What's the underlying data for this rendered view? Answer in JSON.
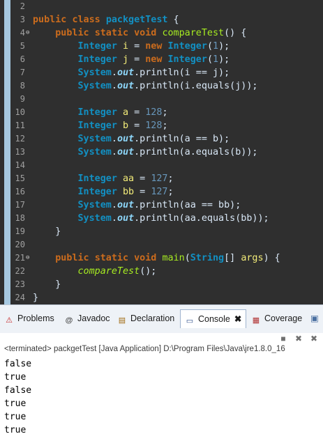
{
  "editor": {
    "lines": [
      {
        "num": "2",
        "fold": "",
        "tokens": []
      },
      {
        "num": "3",
        "fold": "",
        "tokens": [
          [
            "kw",
            "public"
          ],
          [
            "pl",
            " "
          ],
          [
            "kw",
            "class"
          ],
          [
            "pl",
            " "
          ],
          [
            "ty",
            "packgetTest"
          ],
          [
            "pl",
            " {"
          ]
        ]
      },
      {
        "num": "4",
        "fold": "⊖",
        "tokens": [
          [
            "pl",
            "    "
          ],
          [
            "kw",
            "public"
          ],
          [
            "pl",
            " "
          ],
          [
            "kw",
            "static"
          ],
          [
            "pl",
            " "
          ],
          [
            "kw",
            "void"
          ],
          [
            "pl",
            " "
          ],
          [
            "fn",
            "compareTest"
          ],
          [
            "pl",
            "() {"
          ]
        ]
      },
      {
        "num": "5",
        "fold": "",
        "tokens": [
          [
            "pl",
            "        "
          ],
          [
            "ty",
            "Integer"
          ],
          [
            "pl",
            " "
          ],
          [
            "va",
            "i"
          ],
          [
            "pl",
            " = "
          ],
          [
            "kw",
            "new"
          ],
          [
            "pl",
            " "
          ],
          [
            "ty",
            "Integer"
          ],
          [
            "pl",
            "("
          ],
          [
            "nb",
            "1"
          ],
          [
            "pl",
            ");"
          ]
        ]
      },
      {
        "num": "6",
        "fold": "",
        "tokens": [
          [
            "pl",
            "        "
          ],
          [
            "ty",
            "Integer"
          ],
          [
            "pl",
            " "
          ],
          [
            "va",
            "j"
          ],
          [
            "pl",
            " = "
          ],
          [
            "kw",
            "new"
          ],
          [
            "pl",
            " "
          ],
          [
            "ty",
            "Integer"
          ],
          [
            "pl",
            "("
          ],
          [
            "nb",
            "1"
          ],
          [
            "pl",
            ");"
          ]
        ]
      },
      {
        "num": "7",
        "fold": "",
        "tokens": [
          [
            "pl",
            "        "
          ],
          [
            "ty",
            "System"
          ],
          [
            "pl",
            "."
          ],
          [
            "fi",
            "out"
          ],
          [
            "pl",
            ".println(i == j);"
          ]
        ]
      },
      {
        "num": "8",
        "fold": "",
        "tokens": [
          [
            "pl",
            "        "
          ],
          [
            "ty",
            "System"
          ],
          [
            "pl",
            "."
          ],
          [
            "fi",
            "out"
          ],
          [
            "pl",
            ".println(i.equals(j));"
          ]
        ]
      },
      {
        "num": "9",
        "fold": "",
        "tokens": []
      },
      {
        "num": "10",
        "fold": "",
        "tokens": [
          [
            "pl",
            "        "
          ],
          [
            "ty",
            "Integer"
          ],
          [
            "pl",
            " "
          ],
          [
            "va",
            "a"
          ],
          [
            "pl",
            " = "
          ],
          [
            "nb",
            "128"
          ],
          [
            "pl",
            ";"
          ]
        ]
      },
      {
        "num": "11",
        "fold": "",
        "tokens": [
          [
            "pl",
            "        "
          ],
          [
            "ty",
            "Integer"
          ],
          [
            "pl",
            " "
          ],
          [
            "va",
            "b"
          ],
          [
            "pl",
            " = "
          ],
          [
            "nb",
            "128"
          ],
          [
            "pl",
            ";"
          ]
        ]
      },
      {
        "num": "12",
        "fold": "",
        "tokens": [
          [
            "pl",
            "        "
          ],
          [
            "ty",
            "System"
          ],
          [
            "pl",
            "."
          ],
          [
            "fi",
            "out"
          ],
          [
            "pl",
            ".println(a == b);"
          ]
        ]
      },
      {
        "num": "13",
        "fold": "",
        "tokens": [
          [
            "pl",
            "        "
          ],
          [
            "ty",
            "System"
          ],
          [
            "pl",
            "."
          ],
          [
            "fi",
            "out"
          ],
          [
            "pl",
            ".println(a.equals(b));"
          ]
        ]
      },
      {
        "num": "14",
        "fold": "",
        "tokens": []
      },
      {
        "num": "15",
        "fold": "",
        "tokens": [
          [
            "pl",
            "        "
          ],
          [
            "ty",
            "Integer"
          ],
          [
            "pl",
            " "
          ],
          [
            "va",
            "aa"
          ],
          [
            "pl",
            " = "
          ],
          [
            "nb",
            "127"
          ],
          [
            "pl",
            ";"
          ]
        ]
      },
      {
        "num": "16",
        "fold": "",
        "tokens": [
          [
            "pl",
            "        "
          ],
          [
            "ty",
            "Integer"
          ],
          [
            "pl",
            " "
          ],
          [
            "va",
            "bb"
          ],
          [
            "pl",
            " = "
          ],
          [
            "nb",
            "127"
          ],
          [
            "pl",
            ";"
          ]
        ]
      },
      {
        "num": "17",
        "fold": "",
        "tokens": [
          [
            "pl",
            "        "
          ],
          [
            "ty",
            "System"
          ],
          [
            "pl",
            "."
          ],
          [
            "fi",
            "out"
          ],
          [
            "pl",
            ".println(aa == bb);"
          ]
        ]
      },
      {
        "num": "18",
        "fold": "",
        "tokens": [
          [
            "pl",
            "        "
          ],
          [
            "ty",
            "System"
          ],
          [
            "pl",
            "."
          ],
          [
            "fi",
            "out"
          ],
          [
            "pl",
            ".println(aa.equals(bb));"
          ]
        ]
      },
      {
        "num": "19",
        "fold": "",
        "tokens": [
          [
            "pl",
            "    }"
          ]
        ]
      },
      {
        "num": "20",
        "fold": "",
        "tokens": []
      },
      {
        "num": "21",
        "fold": "⊖",
        "tokens": [
          [
            "pl",
            "    "
          ],
          [
            "kw",
            "public"
          ],
          [
            "pl",
            " "
          ],
          [
            "kw",
            "static"
          ],
          [
            "pl",
            " "
          ],
          [
            "kw",
            "void"
          ],
          [
            "pl",
            " "
          ],
          [
            "fn",
            "main"
          ],
          [
            "pl",
            "("
          ],
          [
            "ty",
            "String"
          ],
          [
            "pl",
            "[] "
          ],
          [
            "va",
            "args"
          ],
          [
            "pl",
            ") {"
          ]
        ]
      },
      {
        "num": "22",
        "fold": "",
        "tokens": [
          [
            "pl",
            "        "
          ],
          [
            "ca",
            "compareTest"
          ],
          [
            "pl",
            "();"
          ]
        ]
      },
      {
        "num": "23",
        "fold": "",
        "tokens": [
          [
            "pl",
            "    }"
          ]
        ]
      },
      {
        "num": "24",
        "fold": "",
        "tokens": [
          [
            "pl",
            "}"
          ]
        ]
      }
    ]
  },
  "panel": {
    "tabs": [
      {
        "label": "Problems",
        "icon": "problems-icon",
        "glyph": "⚠",
        "color": "#c62828"
      },
      {
        "label": "Javadoc",
        "icon": "javadoc-icon",
        "glyph": "@",
        "color": "#4a4a4a"
      },
      {
        "label": "Declaration",
        "icon": "declaration-icon",
        "glyph": "▤",
        "color": "#a06a10"
      },
      {
        "label": "Console",
        "icon": "console-icon",
        "glyph": "▭",
        "color": "#2e4f8a",
        "active": true
      },
      {
        "label": "Coverage",
        "icon": "coverage-icon",
        "glyph": "▦",
        "color": "#b03030"
      }
    ],
    "console_close_glyph": "✖",
    "toolbar": [
      "terminate-icon",
      "remove-launch-icon",
      "remove-all-icon"
    ],
    "status": "<terminated> packgetTest [Java Application] D:\\Program Files\\Java\\jre1.8.0_16",
    "output": [
      "false",
      "true",
      "false",
      "true",
      "true",
      "true"
    ]
  }
}
